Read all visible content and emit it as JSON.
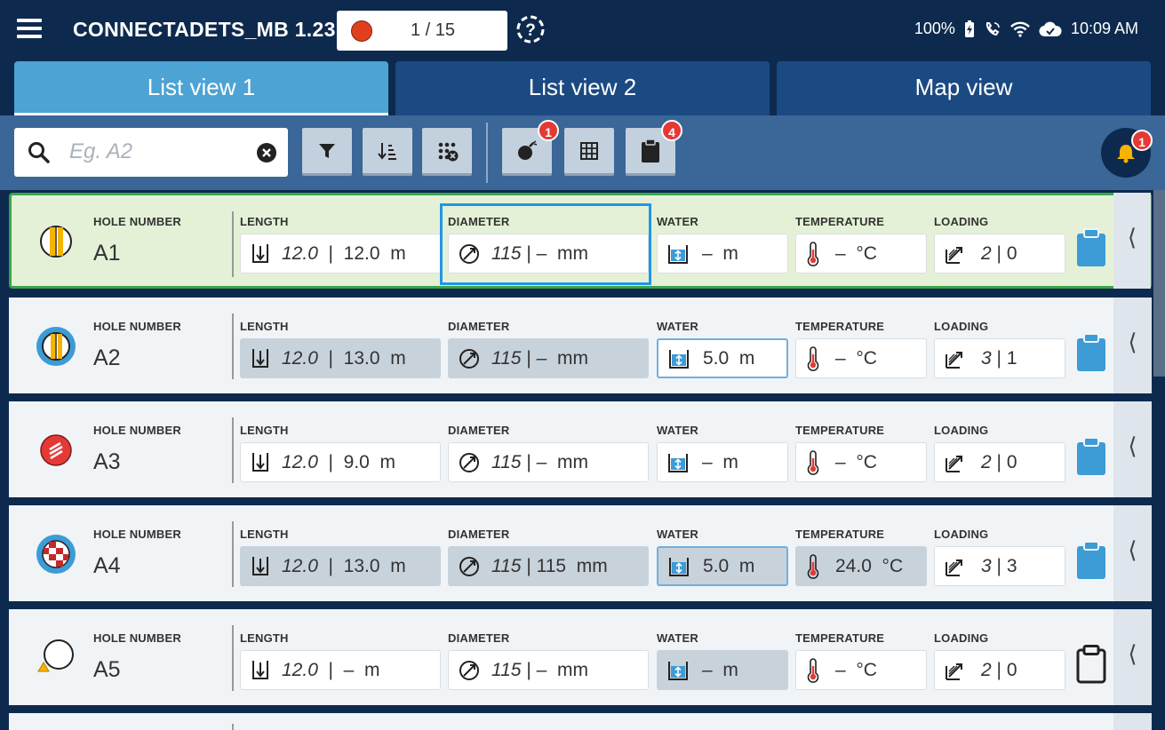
{
  "app": {
    "title": "CONNECTADETS_MB 1.23",
    "record_counter": "1 / 15"
  },
  "status_bar": {
    "battery": "100%",
    "time": "10:09 AM"
  },
  "tabs": [
    {
      "label": "List view 1",
      "active": true
    },
    {
      "label": "List view 2",
      "active": false
    },
    {
      "label": "Map view",
      "active": false
    }
  ],
  "search": {
    "placeholder": "Eg. A2",
    "value": ""
  },
  "toolbar": {
    "buttons": [
      "filter-icon",
      "sort-icon",
      "pattern-icon",
      "explosive-icon",
      "grid-icon",
      "clipboard-icon"
    ],
    "explosive_badge": "1",
    "clipboard_badge": "4",
    "notification_badge": "1"
  },
  "labels": {
    "hole": "HOLE NUMBER",
    "length": "LENGTH",
    "diameter": "DIAMETER",
    "water": "WATER",
    "temperature": "TEMPERATURE",
    "loading": "LOADING"
  },
  "rows": [
    {
      "hole": "A1",
      "length_design": "12.0",
      "length_measured": "|  12.0  m",
      "diam_design": "115",
      "diam_measured": "| –  mm",
      "water": "–  m",
      "temp": "–  °C",
      "load_design": "2",
      "load_measured": "| 0"
    },
    {
      "hole": "A2",
      "length_design": "12.0",
      "length_measured": "|  13.0  m",
      "diam_design": "115",
      "diam_measured": "| –  mm",
      "water": "5.0  m",
      "temp": "–  °C",
      "load_design": "3",
      "load_measured": "| 1"
    },
    {
      "hole": "A3",
      "length_design": "12.0",
      "length_measured": "|  9.0  m",
      "diam_design": "115",
      "diam_measured": "| –  mm",
      "water": "–  m",
      "temp": "–  °C",
      "load_design": "2",
      "load_measured": "| 0"
    },
    {
      "hole": "A4",
      "length_design": "12.0",
      "length_measured": "|  13.0  m",
      "diam_design": "115",
      "diam_measured": "| 115  mm",
      "water": "5.0  m",
      "temp": "24.0  °C",
      "load_design": "3",
      "load_measured": "| 3"
    },
    {
      "hole": "A5",
      "length_design": "12.0",
      "length_measured": "|  –  m",
      "diam_design": "115",
      "diam_measured": "| –  mm",
      "water": "–  m",
      "temp": "–  °C",
      "load_design": "2",
      "load_measured": "| 0"
    }
  ],
  "colors": {
    "accent": "#4da3d4",
    "header": "#0d2a4e",
    "toolbar": "#3a6698",
    "selected_row": "#e4f1d7",
    "clipboard": "#3d9bd6",
    "badge": "#e53935"
  }
}
